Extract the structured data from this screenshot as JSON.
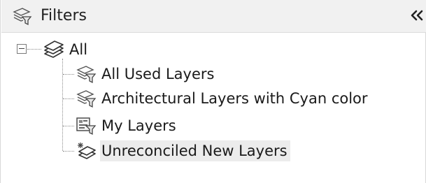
{
  "panel": {
    "title": "Filters",
    "title_icon": "layer-filter-icon",
    "collapse_icon": "double-chevron-left-icon",
    "collapse_glyph": "«"
  },
  "tree": {
    "root": {
      "label": "All",
      "icon": "layers-stack-icon",
      "expanded": true
    },
    "children": [
      {
        "label": "All Used Layers",
        "icon": "layer-filter-icon",
        "selected": false
      },
      {
        "label": "Architectural Layers with Cyan color",
        "icon": "layer-filter-icon",
        "selected": false
      },
      {
        "label": "My Layers",
        "icon": "layer-group-filter-icon",
        "selected": false
      },
      {
        "label": "Unreconciled New Layers",
        "icon": "new-layer-icon",
        "selected": true
      }
    ]
  }
}
